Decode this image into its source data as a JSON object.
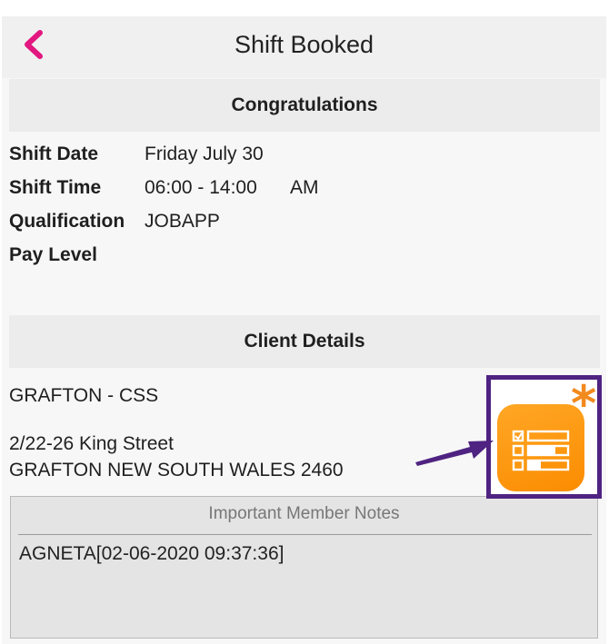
{
  "header": {
    "title": "Shift Booked",
    "back_icon": "chevron-left-icon",
    "accent_color": "#e2177f"
  },
  "congrats": {
    "heading": "Congratulations",
    "rows": [
      {
        "label": "Shift Date",
        "value": "Friday July 30"
      },
      {
        "label": "Shift Time",
        "value": "06:00 - 14:00",
        "suffix": "AM"
      },
      {
        "label": "Qualification",
        "value": "JOBAPP"
      },
      {
        "label": "Pay Level",
        "value": ""
      }
    ]
  },
  "client": {
    "heading": "Client Details",
    "name": "GRAFTON - CSS",
    "address_line1": "2/22-26 King Street",
    "address_line2": "GRAFTON NEW SOUTH WALES 2460"
  },
  "notes": {
    "heading": "Important Member Notes",
    "text": "AGNETA[02-06-2020 09:37:36]"
  },
  "annotation": {
    "icon": "checklist-app-icon",
    "marker": "*",
    "highlight_color": "#4f2381",
    "icon_color": "#f7931e"
  }
}
